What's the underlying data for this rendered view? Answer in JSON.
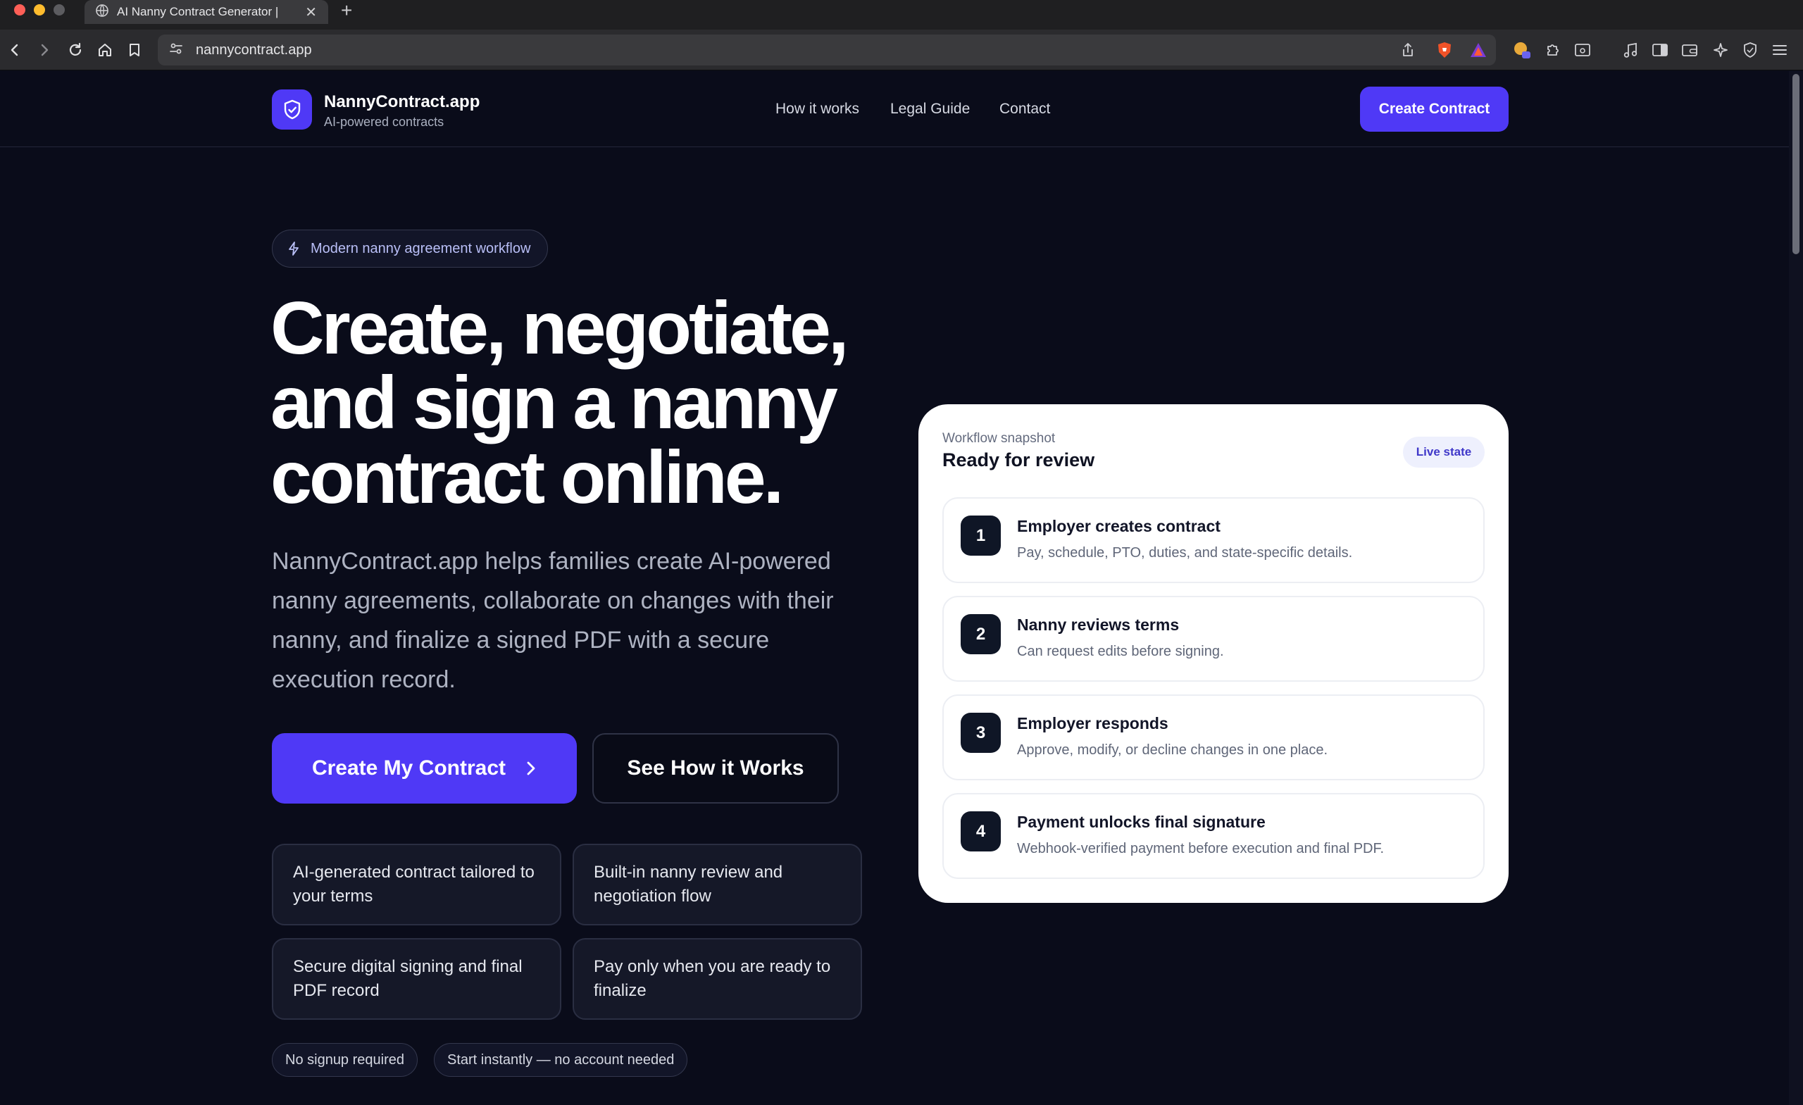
{
  "browser": {
    "tab_title": "AI Nanny Contract Generator |",
    "url": "nannycontract.app"
  },
  "header": {
    "brand_name": "NannyContract.app",
    "brand_sub": "AI-powered contracts",
    "nav": [
      "How it works",
      "Legal Guide",
      "Contact"
    ],
    "cta": "Create Contract"
  },
  "hero": {
    "badge": "Modern nanny agreement workflow",
    "title_lines": [
      "Create, negotiate,",
      "and sign a nanny",
      "contract online."
    ],
    "description": "NannyContract.app helps families create AI-powered nanny agreements, collaborate on changes with their nanny, and finalize a signed PDF with a secure execution record.",
    "primary_cta": "Create My Contract",
    "secondary_cta": "See How it Works",
    "features": [
      "AI-generated contract tailored to your terms",
      "Built-in nanny review and negotiation flow",
      "Secure digital signing and final PDF record",
      "Pay only when you are ready to finalize"
    ],
    "pills": [
      "No signup required",
      "Start instantly — no account needed"
    ]
  },
  "workflow": {
    "kicker": "Workflow snapshot",
    "title": "Ready for review",
    "badge": "Live state",
    "steps": [
      {
        "num": "1",
        "title": "Employer creates contract",
        "desc": "Pay, schedule, PTO, duties, and state-specific details."
      },
      {
        "num": "2",
        "title": "Nanny reviews terms",
        "desc": "Can request edits before signing."
      },
      {
        "num": "3",
        "title": "Employer responds",
        "desc": "Approve, modify, or decline changes in one place."
      },
      {
        "num": "4",
        "title": "Payment unlocks final signature",
        "desc": "Webhook-verified payment before execution and final PDF."
      }
    ]
  },
  "colors": {
    "accent": "#4f39f6",
    "background": "#0a0c1a",
    "card": "#ffffff"
  }
}
